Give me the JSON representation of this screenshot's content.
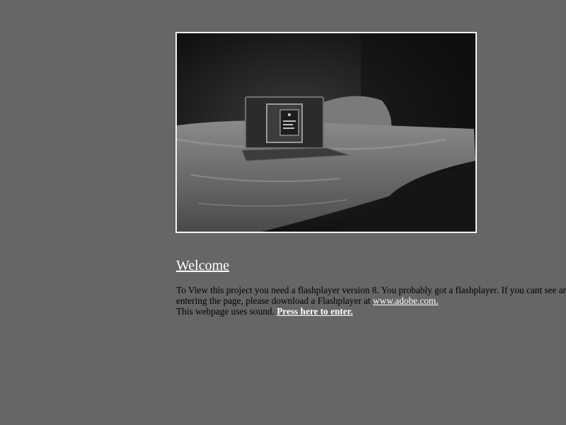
{
  "photo": {
    "description_icon": "laptop-on-bed-photo"
  },
  "welcome": {
    "heading": "Welcome"
  },
  "info": {
    "line1": "To View this project you need a flashplayer version 8. You probably got a flashplayer. If you cant see anything after",
    "line2_prefix": "entering the page, please download a Flashplayer at ",
    "adobe_link": "www.adobe.com.",
    "line3_prefix": "This webpage uses sound. ",
    "enter_link": "Press here to enter."
  },
  "colors": {
    "background": "#666666",
    "link": "#ffffff",
    "text": "#000000",
    "frame": "#f2f2f2"
  }
}
